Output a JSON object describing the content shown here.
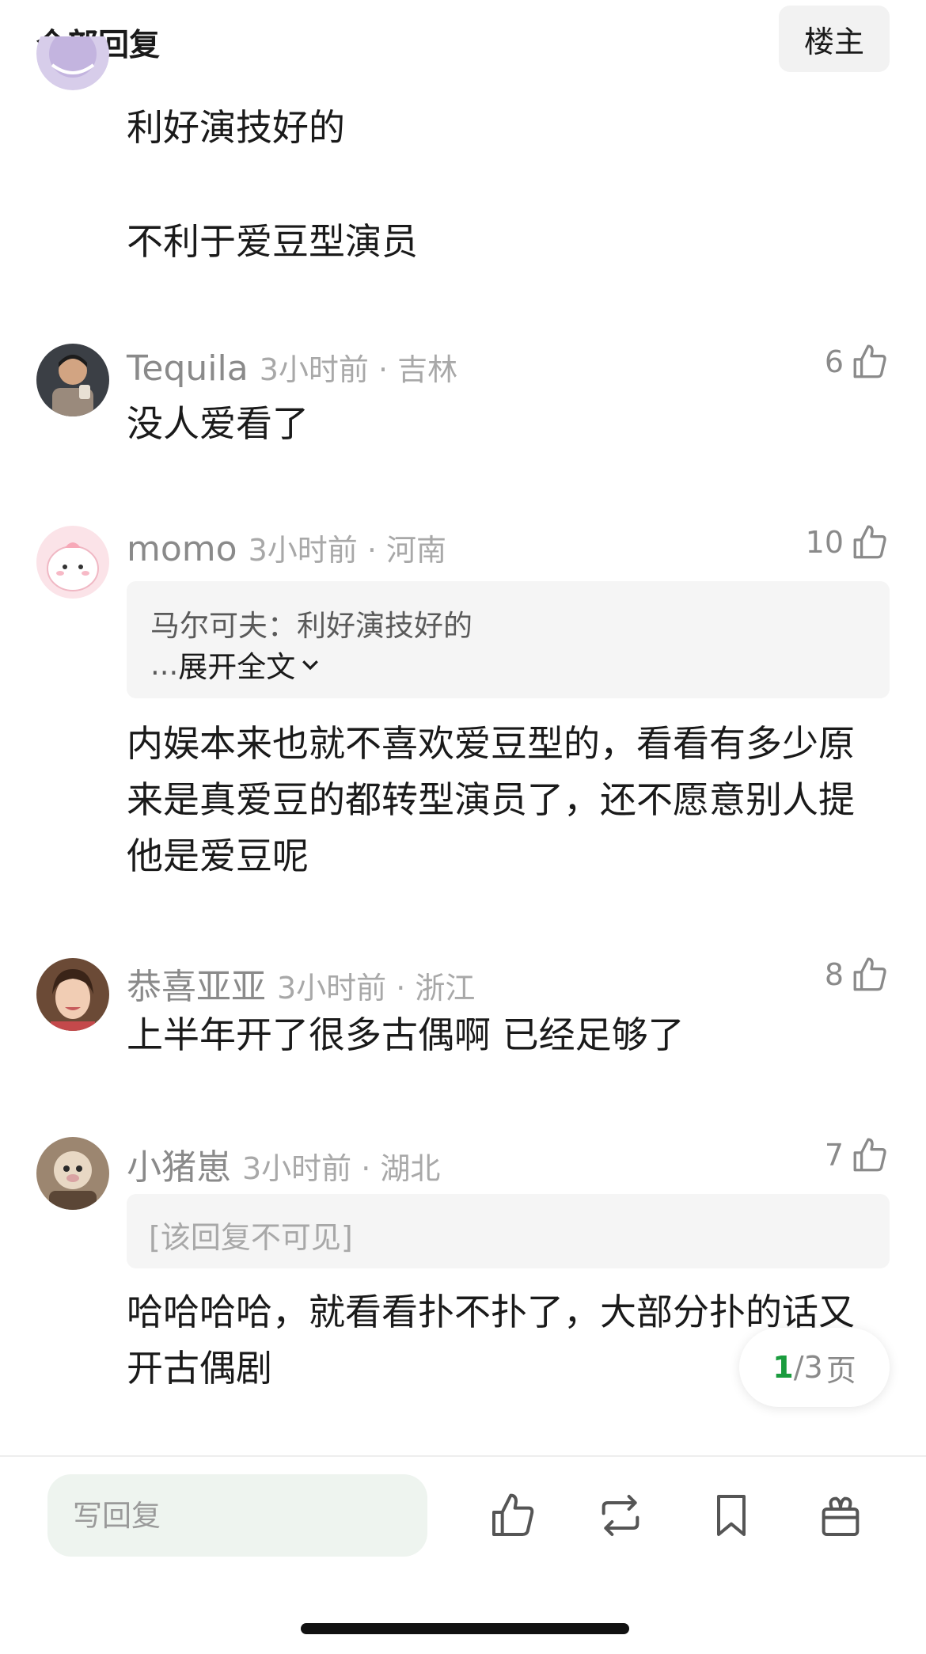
{
  "header": {
    "title": "全部回复",
    "owner_button": "楼主"
  },
  "top_comment": {
    "line1": "利好演技好的",
    "line2": "不利于爱豆型演员"
  },
  "comments": [
    {
      "username": "Tequila",
      "meta": "3小时前 · 吉林",
      "likes": "6",
      "text": "没人爱看了"
    },
    {
      "username": "momo",
      "meta": "3小时前 · 河南",
      "likes": "10",
      "quote": {
        "author": "马尔可夫：",
        "text": "利好演技好的",
        "expand_dots": "...",
        "expand_label": "展开全文"
      },
      "text": "内娱本来也就不喜欢爱豆型的，看看有多少原来是真爱豆的都转型演员了，还不愿意别人提他是爱豆呢"
    },
    {
      "username": "恭喜亚亚",
      "meta": "3小时前 · 浙江",
      "likes": "8",
      "text": "上半年开了很多古偶啊 已经足够了"
    },
    {
      "username": "小猪崽",
      "meta": "3小时前 · 湖北",
      "likes": "7",
      "hidden_quote": "[该回复不可见]",
      "text": "哈哈哈哈，就看看扑不扑了，大部分扑的话又开古偶剧"
    }
  ],
  "pager": {
    "current": "1",
    "total": "/3",
    "unit": "页"
  },
  "bottom_bar": {
    "reply_placeholder": "写回复",
    "icons": [
      "like-icon",
      "repost-icon",
      "bookmark-icon",
      "gift-icon"
    ]
  },
  "colors": {
    "accent_green": "#1a9c3e",
    "meta_gray": "#a8a8a8",
    "input_bg": "#eef4ef"
  }
}
